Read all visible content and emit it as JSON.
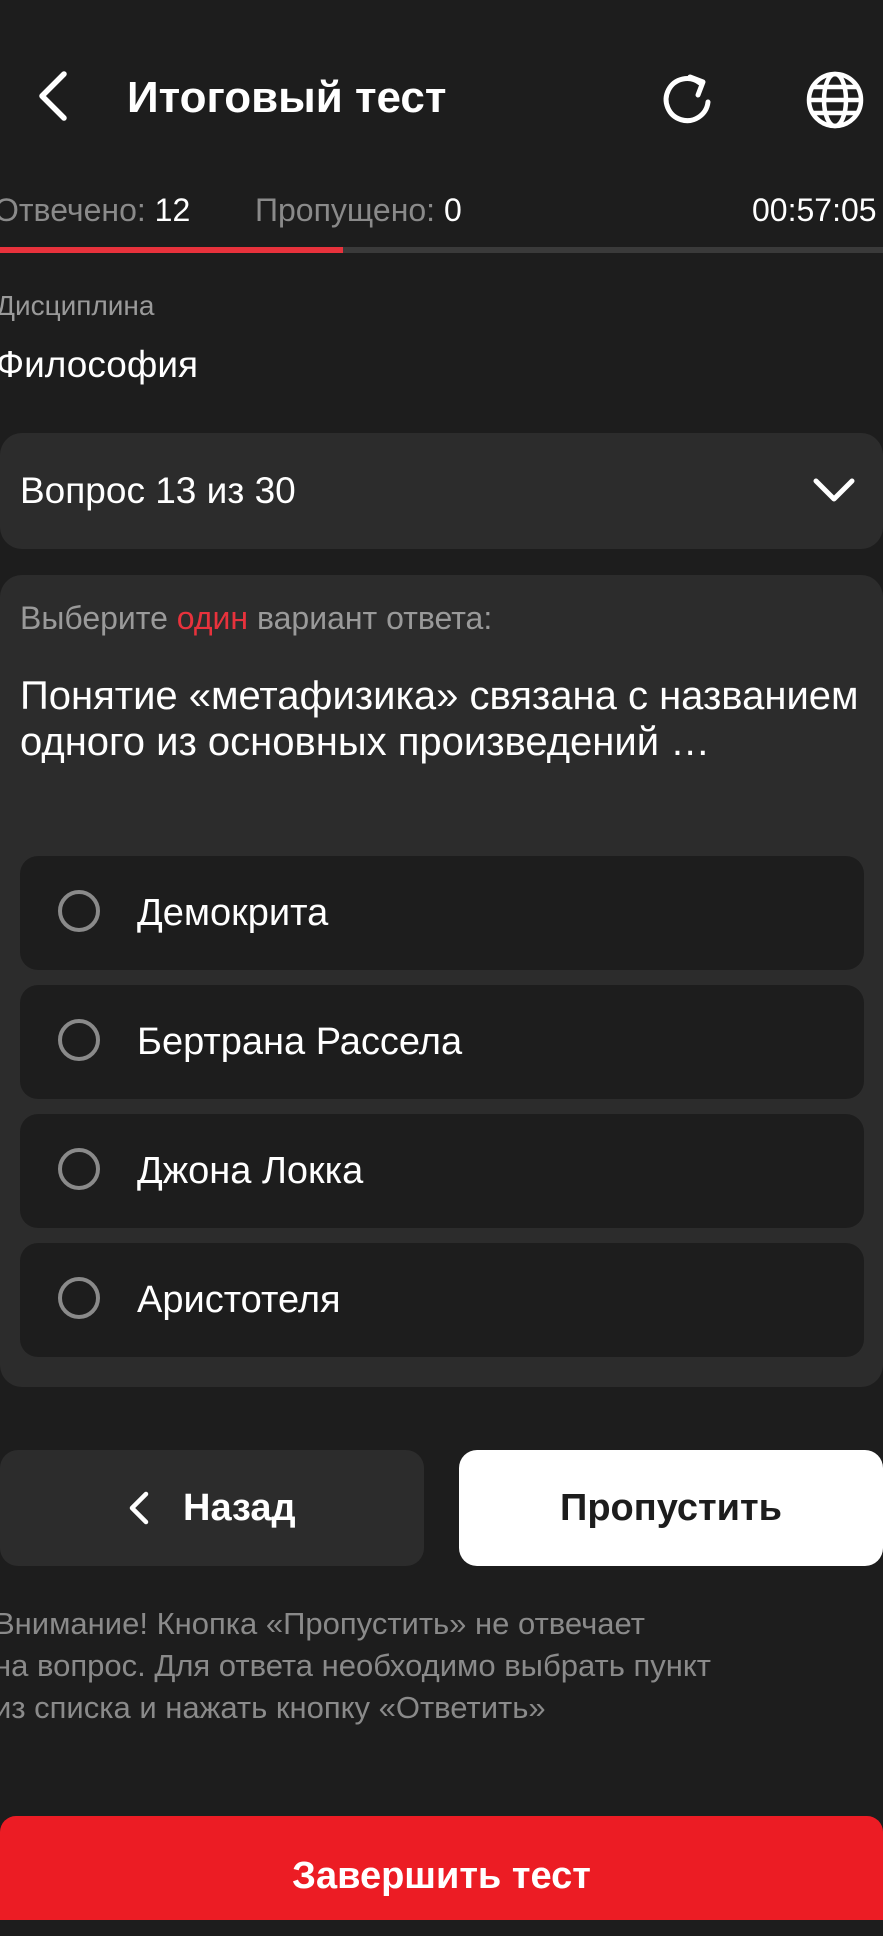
{
  "header": {
    "title": "Итоговый тест",
    "icons": [
      "back-arrow-icon",
      "refresh-icon",
      "globe-icon"
    ]
  },
  "stats": {
    "answered_label": "Отвечено:",
    "answered_value": "12",
    "skipped_label": "Пропущено:",
    "skipped_value": "0",
    "timer": "00:57:05"
  },
  "progress": {
    "fraction": 0.388,
    "fill_color": "#e8323c",
    "track_color": "#3a3a3a"
  },
  "discipline": {
    "label": "Дисциплина",
    "value": "Философия"
  },
  "question_selector": {
    "label": "Вопрос 13 из 30"
  },
  "question": {
    "instruction_before": "Выберите",
    "instruction_accent": "один",
    "instruction_after": "вариант ответа:",
    "text": "Понятие «метафизика» связана с названием одного из основных произведений …",
    "options": [
      {
        "label": "Демокрита"
      },
      {
        "label": "Бертрана Рассела"
      },
      {
        "label": "Джона Локка"
      },
      {
        "label": "Аристотеля"
      }
    ]
  },
  "nav": {
    "back_label": "Назад",
    "skip_label": "Пропустить"
  },
  "notice": {
    "line1": "Внимание! Кнопка «Пропустить» не отвечает",
    "line2": "на вопрос. Для ответа необходимо выбрать пункт",
    "line3": "из списка и нажать кнопку «Ответить»"
  },
  "finish": {
    "label": "Завершить тест"
  },
  "colors": {
    "background": "#1d1d1d",
    "card": "#2c2c2c",
    "accent": "#e8323c",
    "finish_button": "#ec1c24"
  }
}
